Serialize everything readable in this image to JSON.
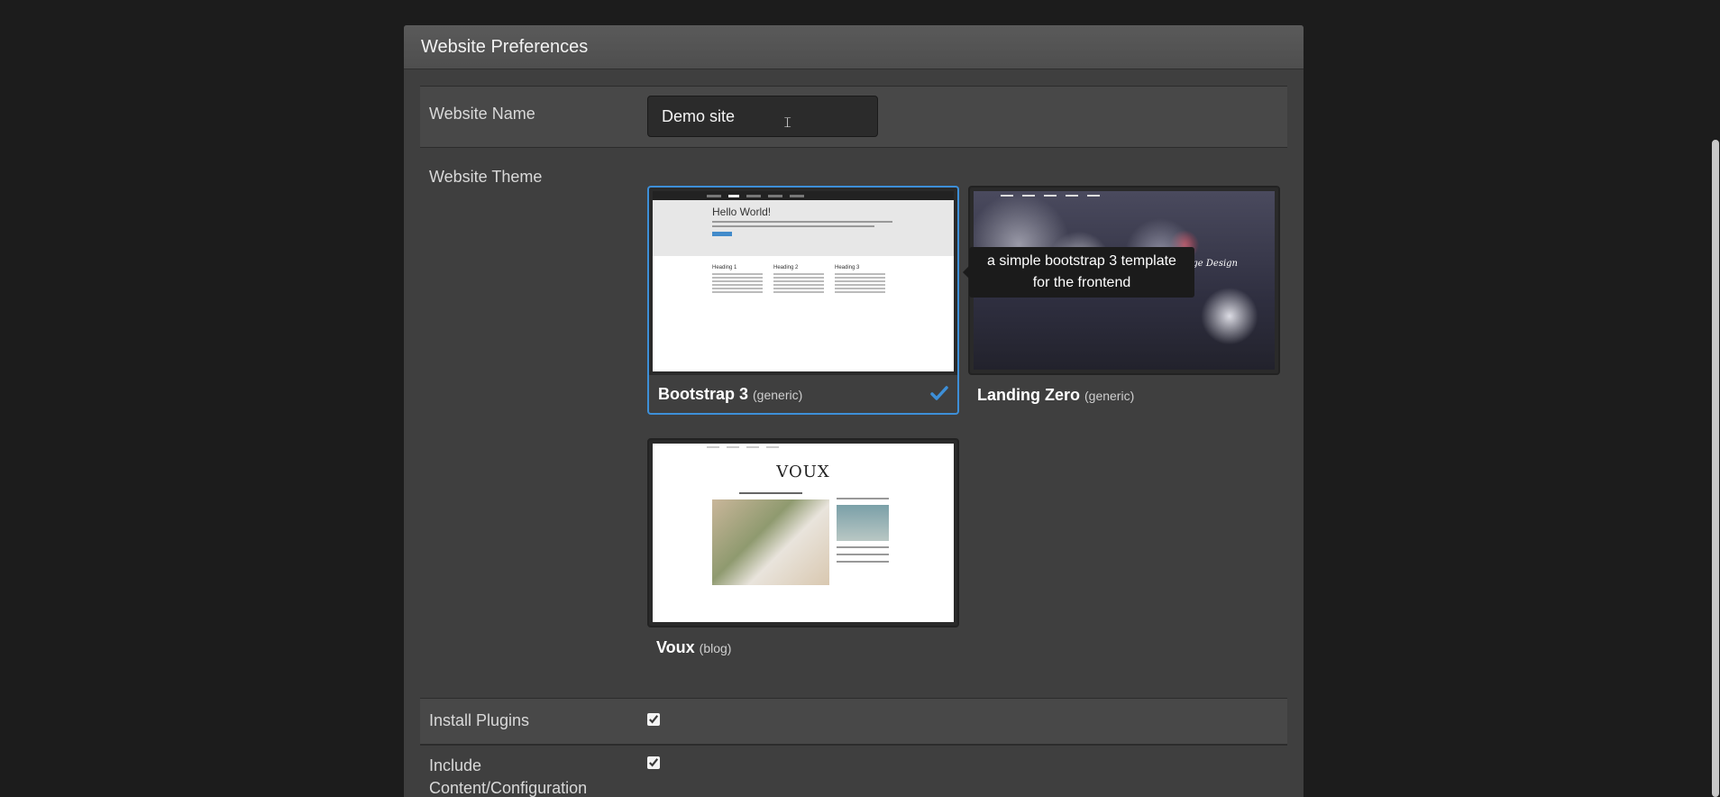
{
  "panel": {
    "title": "Website Preferences"
  },
  "website_name": {
    "label": "Website Name",
    "value": "Demo site"
  },
  "website_theme": {
    "label": "Website Theme",
    "themes": [
      {
        "name": "Bootstrap 3",
        "type": "(generic)",
        "selected": true
      },
      {
        "name": "Landing Zero",
        "type": "(generic)",
        "selected": false
      },
      {
        "name": "Voux",
        "type": "(blog)",
        "selected": false
      }
    ],
    "tooltip": "a simple bootstrap 3 template for the frontend",
    "previews": {
      "bootstrap_heading": "Hello World!",
      "bootstrap_col_headings": [
        "Heading 1",
        "Heading 2",
        "Heading 3"
      ],
      "landing_tagline": "Simple, One Page Design",
      "voux_logo": "VOUX"
    }
  },
  "install_plugins": {
    "label": "Install Plugins",
    "checked": true
  },
  "include_content": {
    "label": "Include Content/Configuration",
    "checked": true
  },
  "colors": {
    "accent": "#3d8fd8",
    "panel_bg": "#3f3f3f",
    "page_bg": "#1c1c1c"
  }
}
